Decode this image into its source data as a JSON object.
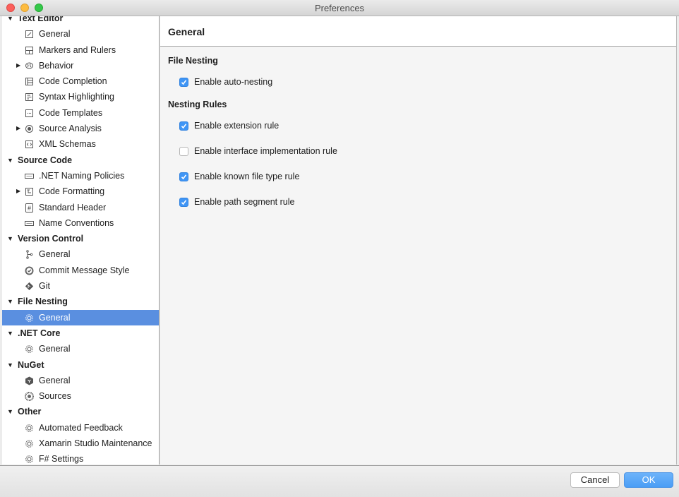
{
  "window": {
    "title": "Preferences"
  },
  "sidebar": {
    "categories": [
      {
        "label": "Text Editor",
        "items": [
          {
            "label": "General",
            "icon": "pencil-icon",
            "expandable": false
          },
          {
            "label": "Markers and Rulers",
            "icon": "grid-icon",
            "expandable": false
          },
          {
            "label": "Behavior",
            "icon": "brain-icon",
            "expandable": true
          },
          {
            "label": "Code Completion",
            "icon": "list-icon",
            "expandable": false
          },
          {
            "label": "Syntax Highlighting",
            "icon": "syntax-icon",
            "expandable": false
          },
          {
            "label": "Code Templates",
            "icon": "ellipsis-box-icon",
            "expandable": false
          },
          {
            "label": "Source Analysis",
            "icon": "target-icon",
            "expandable": true
          },
          {
            "label": "XML Schemas",
            "icon": "xml-icon",
            "expandable": false
          }
        ]
      },
      {
        "label": "Source Code",
        "items": [
          {
            "label": ".NET Naming Policies",
            "icon": "naming-icon",
            "expandable": false
          },
          {
            "label": "Code Formatting",
            "icon": "formatting-icon",
            "expandable": true
          },
          {
            "label": "Standard Header",
            "icon": "hash-icon",
            "expandable": false
          },
          {
            "label": "Name Conventions",
            "icon": "conventions-icon",
            "expandable": false
          }
        ]
      },
      {
        "label": "Version Control",
        "items": [
          {
            "label": "General",
            "icon": "branch-icon",
            "expandable": false
          },
          {
            "label": "Commit Message Style",
            "icon": "check-circle-icon",
            "expandable": false
          },
          {
            "label": "Git",
            "icon": "git-icon",
            "expandable": false
          }
        ]
      },
      {
        "label": "File Nesting",
        "items": [
          {
            "label": "General",
            "icon": "gear-icon",
            "expandable": false,
            "selected": true
          }
        ]
      },
      {
        "label": ".NET Core",
        "items": [
          {
            "label": "General",
            "icon": "gear-icon",
            "expandable": false
          }
        ]
      },
      {
        "label": "NuGet",
        "items": [
          {
            "label": "General",
            "icon": "nuget-icon",
            "expandable": false
          },
          {
            "label": "Sources",
            "icon": "sources-icon",
            "expandable": false
          }
        ]
      },
      {
        "label": "Other",
        "items": [
          {
            "label": "Automated Feedback",
            "icon": "gear-icon",
            "expandable": false
          },
          {
            "label": "Xamarin Studio Maintenance",
            "icon": "gear-icon",
            "expandable": false
          },
          {
            "label": "F# Settings",
            "icon": "gear-icon",
            "expandable": false
          }
        ]
      }
    ]
  },
  "main": {
    "title": "General",
    "file_nesting": {
      "heading": "File Nesting",
      "auto_nesting": {
        "label": "Enable auto-nesting",
        "checked": true
      }
    },
    "nesting_rules": {
      "heading": "Nesting Rules",
      "rules": [
        {
          "label": "Enable extension rule",
          "checked": true
        },
        {
          "label": "Enable interface implementation rule",
          "checked": false
        },
        {
          "label": "Enable known file type rule",
          "checked": true
        },
        {
          "label": "Enable path segment rule",
          "checked": true
        }
      ]
    }
  },
  "footer": {
    "cancel_label": "Cancel",
    "ok_label": "OK"
  },
  "colors": {
    "selection": "#5a8fe0",
    "checkbox": "#3f95f5",
    "ok_button": "#55a5f7"
  }
}
